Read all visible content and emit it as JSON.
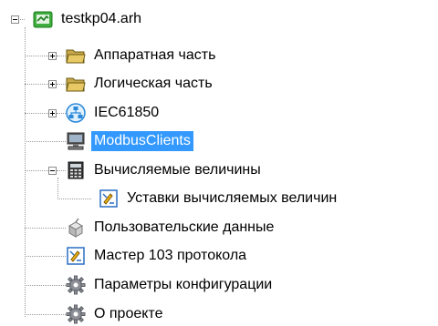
{
  "tree": {
    "root": {
      "label": "testkp04.arh",
      "icon": "archive-icon",
      "expanded": true
    },
    "items": [
      {
        "label": "Аппаратная часть",
        "icon": "folder-icon",
        "expander": "plus"
      },
      {
        "label": "Логическая часть",
        "icon": "folder-icon",
        "expander": "plus"
      },
      {
        "label": "IEC61850",
        "icon": "network-icon",
        "expander": "plus"
      },
      {
        "label": "ModbusClients",
        "icon": "computer-icon",
        "expander": "none",
        "selected": true
      },
      {
        "label": "Вычисляемые величины",
        "icon": "calculator-icon",
        "expander": "minus",
        "children": [
          {
            "label": "Уставки вычисляемых величин",
            "icon": "settings-document-icon"
          }
        ]
      },
      {
        "label": "Пользовательские данные",
        "icon": "user-data-icon",
        "expander": "none"
      },
      {
        "label": "Мастер 103 протокола",
        "icon": "settings-document-icon",
        "expander": "none"
      },
      {
        "label": "Параметры конфигурации",
        "icon": "gear-icon",
        "expander": "none"
      },
      {
        "label": "О проекте",
        "icon": "gear-icon",
        "expander": "none"
      }
    ]
  },
  "colors": {
    "selection": "#3399ff",
    "selection_text": "#ffffff",
    "tree_lines": "#9a9a9a"
  }
}
